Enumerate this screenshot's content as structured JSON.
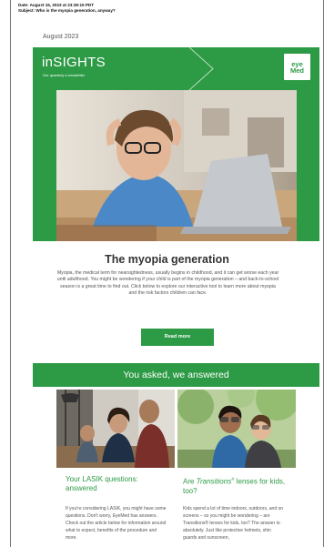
{
  "email_meta": {
    "date_line": "Date: August 15, 2023 at 23:39:15 PDT",
    "subject_line": "Subject: Who is the myopia generation, anyway?"
  },
  "issue_date": "August 2023",
  "header": {
    "title": "inSIGHTS",
    "subtitle": "Our quarterly e-newsletter",
    "logo_line1": "eye",
    "logo_line2": "Med",
    "colors": {
      "brand_green": "#2d9a45"
    }
  },
  "article": {
    "headline": "The myopia generation",
    "body": "Myopia, the medical term for nearsightedness, usually begins in childhood, and it can get worse each year until adulthood. You might be wondering if your child is part of the myopia generation – and back-to-school season is a great time to find out. Click below to explore our interactive tool to learn more about myopia and the risk factors children can face.",
    "button_label": "Read more"
  },
  "section": {
    "title": "You asked, we answered"
  },
  "cards": [
    {
      "title": "Your LASIK questions: answered",
      "body": "If you're considering LASIK, you might have some questions. Don't worry, EyeMed has answers. Check out the article below for information around what to expect, benefits of the procedure and more."
    },
    {
      "title_prefix": "Are ",
      "title_italic": "Transitions",
      "title_sup": "®",
      "title_suffix": " lenses for kids, too?",
      "body": "Kids spend a lot of time indoors, outdoors, and on screens – so you might be wondering – are Transitions® lenses for kids, too? The answer is: absolutely. Just like protective helmets, shin guards and sunscreen,"
    }
  ]
}
